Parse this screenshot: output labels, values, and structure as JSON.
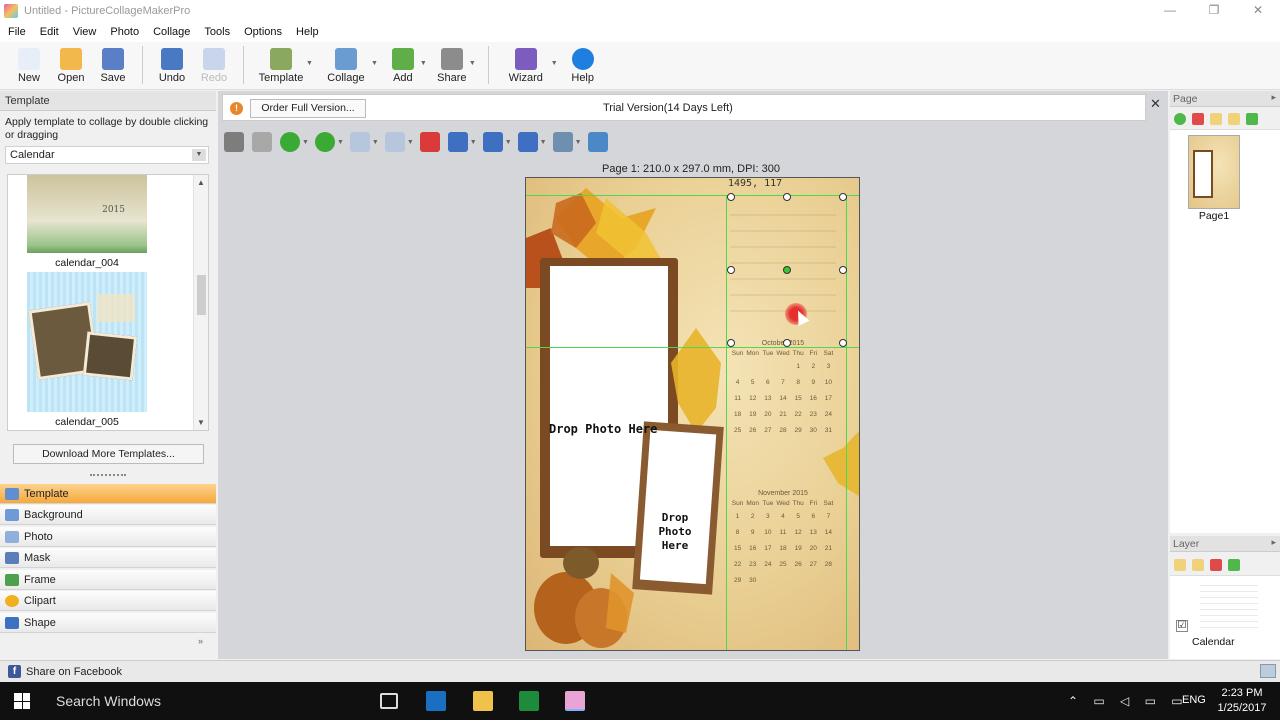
{
  "window": {
    "title": "Untitled - PictureCollageMakerPro",
    "controls": [
      "—",
      "❐",
      "✕"
    ]
  },
  "menu": [
    "File",
    "Edit",
    "View",
    "Photo",
    "Collage",
    "Tools",
    "Options",
    "Help"
  ],
  "toolbar": [
    {
      "label": "New",
      "icon": "new-file-icon",
      "color": "#e8eef8"
    },
    {
      "label": "Open",
      "icon": "open-folder-icon",
      "color": "#f2b84b"
    },
    {
      "label": "Save",
      "icon": "save-disk-icon",
      "color": "#5b7fc7"
    },
    {
      "label": "Undo",
      "icon": "undo-icon",
      "color": "#4a79c4"
    },
    {
      "label": "Redo",
      "icon": "redo-icon",
      "color": "#c9d5ea",
      "disabled": true
    },
    {
      "label": "Template",
      "icon": "template-icon",
      "color": "#8aa95e"
    },
    {
      "label": "Collage",
      "icon": "collage-icon",
      "color": "#6a9bd1"
    },
    {
      "label": "Add",
      "icon": "add-photo-icon",
      "color": "#5fae4a"
    },
    {
      "label": "Share",
      "icon": "printer-icon",
      "color": "#8c8c8c"
    },
    {
      "label": "Wizard",
      "icon": "wizard-wand-icon",
      "color": "#7c5cbf"
    },
    {
      "label": "Help",
      "icon": "help-icon",
      "color": "#1e7fe0"
    }
  ],
  "left_panel": {
    "header": "Template",
    "description": "Apply template to collage by double clicking or dragging",
    "category": "Calendar",
    "templates": [
      {
        "name": "calendar_004"
      },
      {
        "name": "calendar_005"
      }
    ],
    "download_button": "Download More Templates...",
    "nav": [
      {
        "label": "Template",
        "active": true,
        "icon": "template-icon",
        "color": "#5f8fd0"
      },
      {
        "label": "Background",
        "icon": "background-icon",
        "color": "#6f9ad6"
      },
      {
        "label": "Photo",
        "icon": "photo-icon",
        "color": "#8fb0da"
      },
      {
        "label": "Mask",
        "icon": "mask-icon",
        "color": "#5a7fb8"
      },
      {
        "label": "Frame",
        "icon": "frame-icon",
        "color": "#4ea04a"
      },
      {
        "label": "Clipart",
        "icon": "clipart-sun-icon",
        "color": "#f0b020"
      },
      {
        "label": "Shape",
        "icon": "shape-pen-icon",
        "color": "#3d72c0"
      }
    ]
  },
  "status_bar": {
    "share": "Share on Facebook"
  },
  "trial_bar": {
    "order_button": "Order Full Version...",
    "text": "Trial Version(14 Days Left)"
  },
  "edit_tools": [
    {
      "icon": "person-icon",
      "color": "#7d7d7d"
    },
    {
      "icon": "crop-icon",
      "color": "#a8a8a8"
    },
    {
      "icon": "bring-forward-icon",
      "color": "#3aaa35"
    },
    {
      "icon": "send-backward-icon",
      "color": "#3aaa35"
    },
    {
      "icon": "rotate-left-icon",
      "color": "#b6c6dc"
    },
    {
      "icon": "rotate-right-icon",
      "color": "#b6c6dc"
    },
    {
      "icon": "delete-icon",
      "color": "#d93a3a"
    },
    {
      "icon": "align-center-icon",
      "color": "#3f6fc1"
    },
    {
      "icon": "align-left-icon",
      "color": "#3f6fc1"
    },
    {
      "icon": "distribute-icon",
      "color": "#3f6fc1"
    },
    {
      "icon": "image-zoom-icon",
      "color": "#6f8fb0"
    },
    {
      "icon": "save-image-icon",
      "color": "#4a88c8"
    }
  ],
  "canvas": {
    "page_info": "Page 1: 210.0 x 297.0 mm, DPI: 300",
    "coordinates": "1495, 117",
    "drop_text_1": "Drop Photo Here",
    "drop_text_2": "Drop Photo Here",
    "calendars": [
      {
        "month": "October 2015",
        "days_header": [
          "Sun",
          "Mon",
          "Tue",
          "Wed",
          "Thu",
          "Fri",
          "Sat"
        ],
        "weeks": [
          [
            "",
            "",
            "",
            "",
            "1",
            "2",
            "3"
          ],
          [
            "4",
            "5",
            "6",
            "7",
            "8",
            "9",
            "10"
          ],
          [
            "11",
            "12",
            "13",
            "14",
            "15",
            "16",
            "17"
          ],
          [
            "18",
            "19",
            "20",
            "21",
            "22",
            "23",
            "24"
          ],
          [
            "25",
            "26",
            "27",
            "28",
            "29",
            "30",
            "31"
          ]
        ]
      },
      {
        "month": "November 2015",
        "days_header": [
          "Sun",
          "Mon",
          "Tue",
          "Wed",
          "Thu",
          "Fri",
          "Sat"
        ],
        "weeks": [
          [
            "1",
            "2",
            "3",
            "4",
            "5",
            "6",
            "7"
          ],
          [
            "8",
            "9",
            "10",
            "11",
            "12",
            "13",
            "14"
          ],
          [
            "15",
            "16",
            "17",
            "18",
            "19",
            "20",
            "21"
          ],
          [
            "22",
            "23",
            "24",
            "25",
            "26",
            "27",
            "28"
          ],
          [
            "29",
            "30",
            "",
            "",
            "",
            "",
            ""
          ]
        ]
      }
    ]
  },
  "page_panel": {
    "header": "Page",
    "page_label": "Page1"
  },
  "layer_panel": {
    "header": "Layer",
    "layer_label": "Calendar",
    "checked": "☑"
  },
  "taskbar": {
    "search": "Search Windows",
    "language": "ENG",
    "time": "2:23 PM",
    "date": "1/25/2017"
  }
}
